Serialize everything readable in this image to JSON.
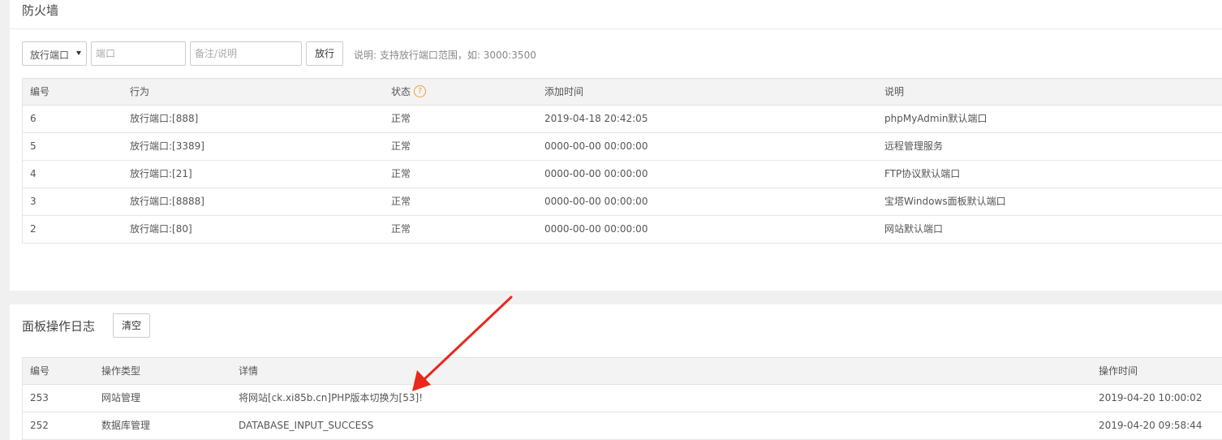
{
  "firewall": {
    "title": "防火墙",
    "controls": {
      "select_value": "放行端口",
      "port_placeholder": "端口",
      "note_placeholder": "备注/说明",
      "allow_button": "放行",
      "hint": "说明: 支持放行端口范围，如: 3000:3500"
    },
    "table": {
      "headers": [
        "编号",
        "行为",
        "状态",
        "添加时间",
        "说明"
      ],
      "help_icon": "?",
      "rows": [
        {
          "id": "6",
          "action": "放行端口:[888]",
          "status": "正常",
          "time": "2019-04-18 20:42:05",
          "note": "phpMyAdmin默认端口"
        },
        {
          "id": "5",
          "action": "放行端口:[3389]",
          "status": "正常",
          "time": "0000-00-00 00:00:00",
          "note": "远程管理服务"
        },
        {
          "id": "4",
          "action": "放行端口:[21]",
          "status": "正常",
          "time": "0000-00-00 00:00:00",
          "note": "FTP协议默认端口"
        },
        {
          "id": "3",
          "action": "放行端口:[8888]",
          "status": "正常",
          "time": "0000-00-00 00:00:00",
          "note": "宝塔Windows面板默认端口"
        },
        {
          "id": "2",
          "action": "放行端口:[80]",
          "status": "正常",
          "time": "0000-00-00 00:00:00",
          "note": "网站默认端口"
        }
      ]
    }
  },
  "log": {
    "title": "面板操作日志",
    "clear_button": "清空",
    "table": {
      "headers": [
        "编号",
        "操作类型",
        "详情",
        "操作时间"
      ],
      "rows": [
        {
          "id": "253",
          "type": "网站管理",
          "detail": "将网站[ck.xi85b.cn]PHP版本切换为[53]!",
          "time": "2019-04-20 10:00:02"
        },
        {
          "id": "252",
          "type": "数据库管理",
          "detail": "DATABASE_INPUT_SUCCESS",
          "time": "2019-04-20 09:58:44"
        }
      ]
    }
  },
  "colors": {
    "annotation_arrow": "#e8291c",
    "help_icon": "#f0a23a"
  }
}
